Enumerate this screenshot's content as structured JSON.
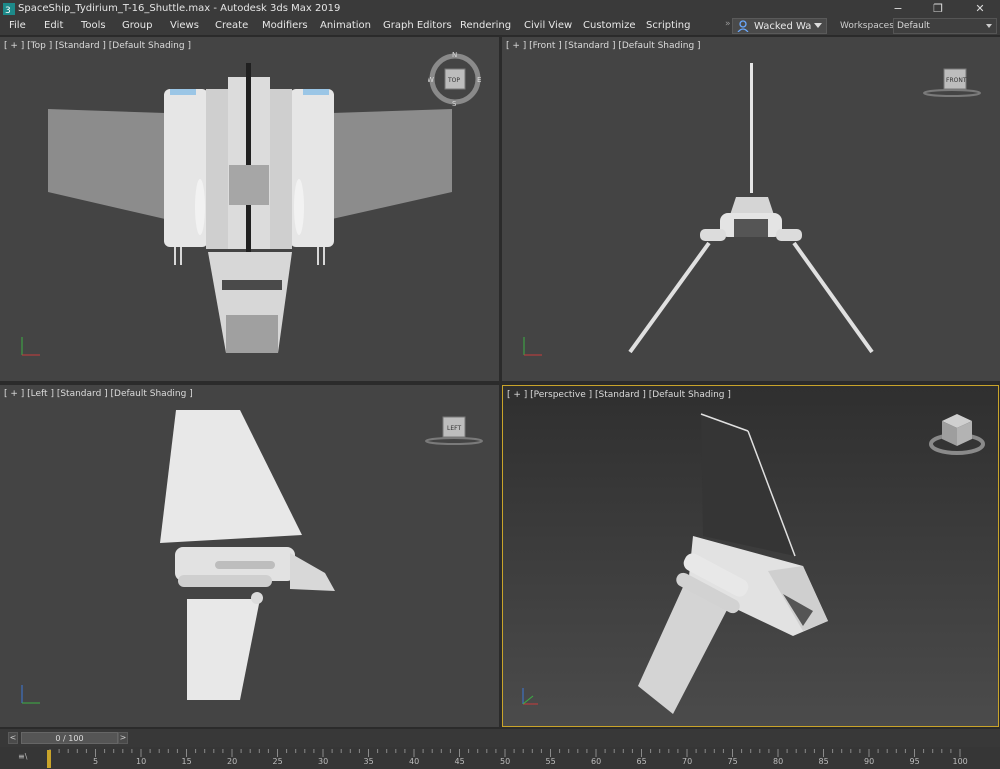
{
  "window": {
    "title": "SpaceShip_Tydirium_T-16_Shuttle.max - Autodesk 3ds Max 2019",
    "minimize": "−",
    "maximize": "❐",
    "close": "✕"
  },
  "menu": {
    "items": [
      "File",
      "Edit",
      "Tools",
      "Group",
      "Views",
      "Create",
      "Modifiers",
      "Animation",
      "Graph Editors",
      "Rendering",
      "Civil View",
      "Customize",
      "Scripting"
    ],
    "user": "Wacked Wa",
    "workspaces_label": "Workspaces:",
    "workspace_value": "Default"
  },
  "viewports": {
    "top": {
      "label": "[ + ] [Top ] [Standard ] [Default Shading ]",
      "cube_label": "TOP"
    },
    "front": {
      "label": "[ + ] [Front ] [Standard ] [Default Shading ]",
      "cube_label": "FRONT"
    },
    "left": {
      "label": "[ + ] [Left ] [Standard ] [Default Shading ]",
      "cube_label": "LEFT"
    },
    "perspective": {
      "label": "[ + ] [Perspective ] [Standard ] [Default Shading ]"
    }
  },
  "compass": {
    "n": "N",
    "s": "S",
    "e": "E",
    "w": "W"
  },
  "timeline": {
    "frame_display": "0 / 100",
    "prev": "<",
    "next": ">",
    "ticks": [
      "5",
      "10",
      "15",
      "20",
      "25",
      "30",
      "35",
      "40",
      "45",
      "50",
      "55",
      "60",
      "65",
      "70",
      "75",
      "80",
      "85",
      "90",
      "95",
      "100"
    ],
    "track_icon": "≡\\"
  },
  "colors": {
    "viewport_bg": "#444444",
    "accent_active": "#c9a42a",
    "model_light": "#e4e4e4",
    "model_dark": "#9a9a9a"
  }
}
